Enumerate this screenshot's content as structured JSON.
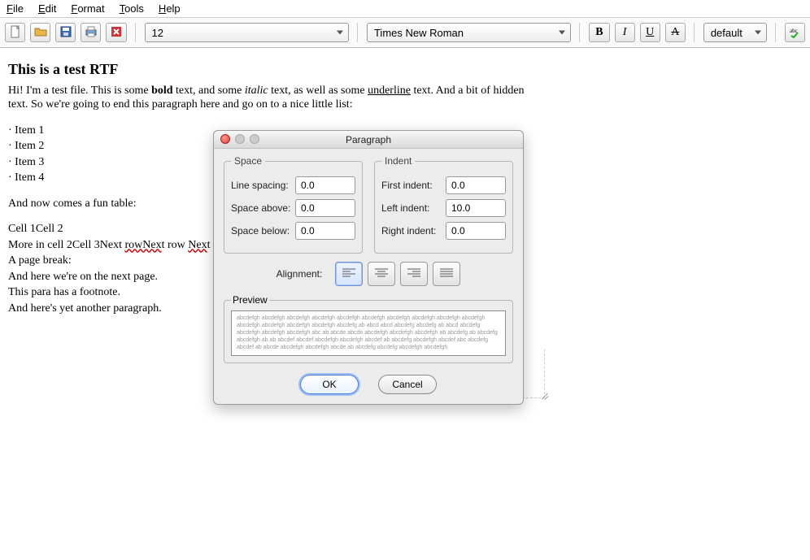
{
  "menubar": {
    "file": {
      "letter": "F",
      "rest": "ile"
    },
    "edit": {
      "letter": "E",
      "rest": "dit"
    },
    "format": {
      "letter": "F",
      "rest": "ormat"
    },
    "tools": {
      "letter": "T",
      "rest": "ools"
    },
    "help": {
      "letter": "H",
      "rest": "elp"
    }
  },
  "toolbar": {
    "font_size": "12",
    "font_family": "Times New Roman",
    "style_combo": "default",
    "bold_btn": "B",
    "italic_btn": "I",
    "underline_btn": "U",
    "strike_btn": "A"
  },
  "document": {
    "title": "This is a test RTF",
    "intro_1": "Hi! I'm a test file. This is some ",
    "intro_bold": "bold",
    "intro_2": " text, and some ",
    "intro_italic": "italic",
    "intro_3": " text, as well as some ",
    "intro_under": "underline",
    "intro_4": " text. And a bit of hidden text. So we're going to end this paragraph here and go on to a nice little list:",
    "items": {
      "0": "Item 1",
      "1": "Item 2",
      "2": "Item 3",
      "3": "Item 4"
    },
    "after_list": "And now comes a fun table:",
    "tbl_line1": "Cell 1Cell 2",
    "tbl_a": "More in cell 2Cell 3Next ",
    "tbl_b": "rowNex",
    "tbl_c": "t row ",
    "tbl_d": "Nex",
    "tbl_e": "t row",
    "page_break": "A page break:",
    "next_page": "And here we're on the next page.",
    "footnote": "This para has a footnote.",
    "another": "And here's yet another paragraph."
  },
  "dialog": {
    "title": "Paragraph",
    "space_legend": "Space",
    "indent_legend": "Indent",
    "preview_legend": "Preview",
    "labels": {
      "line_spacing": "Line spacing:",
      "space_above": "Space above:",
      "space_below": "Space below:",
      "first_indent": "First indent:",
      "left_indent": "Left indent:",
      "right_indent": "Right indent:",
      "alignment": "Alignment:"
    },
    "values": {
      "line_spacing": "0.0",
      "space_above": "0.0",
      "space_below": "0.0",
      "first_indent": "0.0",
      "left_indent": "10.0",
      "right_indent": "0.0"
    },
    "buttons": {
      "ok": "OK",
      "cancel": "Cancel"
    },
    "preview_text": "abcdefgh abcdefgh abcdefgh abcdefgh abcdefgh abcdefgh abcdefgh abcdefgh abcdefgh abcdefgh abcdefgh abcdefgh abcdefgh abcdefgh abcdefg ab abcd abcd abcdefg abcdefg ab abcd abcdefg abcdefgh abcdefgh abcdefgh abc ab abcde abcde abcdefgh abcdefgh abcdefgh ab abcdefg ab abcdefg abcdefgh ab ab abcdef abcdef abcdefgh abcdefgh abcdef ab abcdefg abcdefgh abcdef abc abcdefg abcdef ab abcde abcdefgh abcdefgh abcde ab abcdefg abcdefg abcdefgh abcdefgh"
  }
}
